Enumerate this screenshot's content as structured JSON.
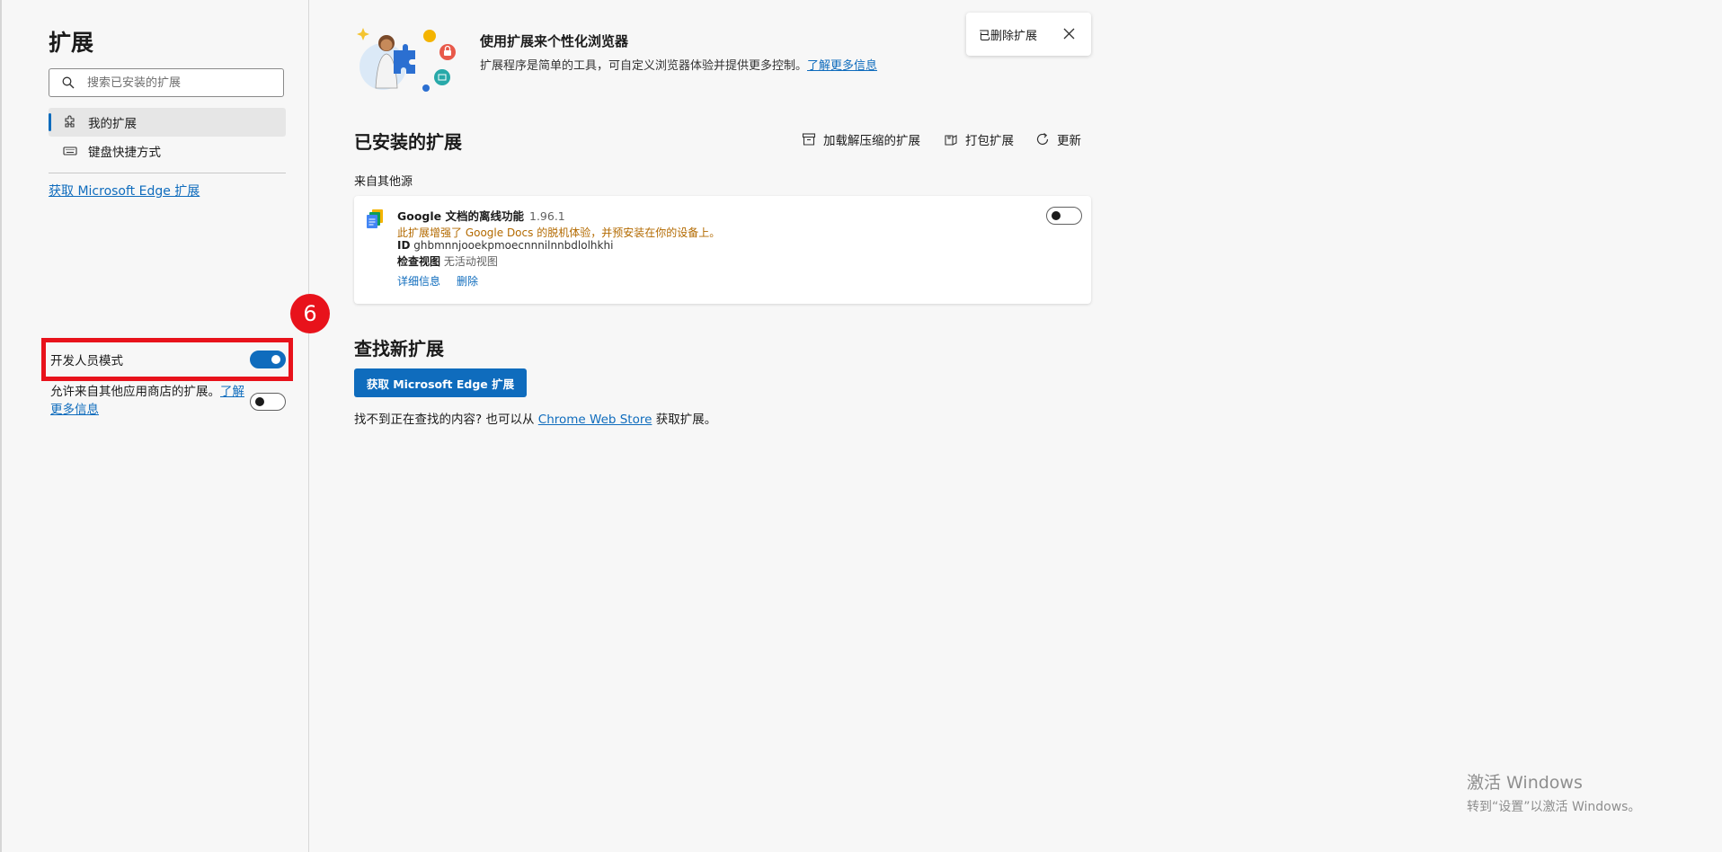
{
  "sidebar": {
    "title": "扩展",
    "search_placeholder": "搜索已安装的扩展",
    "items": [
      {
        "label": "我的扩展",
        "icon": "puzzle-icon",
        "active": true
      },
      {
        "label": "键盘快捷方式",
        "icon": "keyboard-icon",
        "active": false
      }
    ],
    "get_link": "获取 Microsoft Edge 扩展",
    "step_badge": "6",
    "developer_mode": {
      "label": "开发人员模式",
      "on": true
    },
    "allow_other_stores": {
      "text": "允许来自其他应用商店的扩展。",
      "link": "了解更多信息",
      "on": false
    }
  },
  "header": {
    "title": "使用扩展来个性化浏览器",
    "description": "扩展程序是简单的工具，可自定义浏览器体验并提供更多控制。",
    "learn_more": "了解更多信息"
  },
  "toast": {
    "text": "已删除扩展",
    "icon": "close-icon"
  },
  "installed": {
    "title": "已安装的扩展",
    "actions": [
      {
        "label": "加载解压缩的扩展",
        "icon": "archive-icon"
      },
      {
        "label": "打包扩展",
        "icon": "package-icon"
      },
      {
        "label": "更新",
        "icon": "refresh-icon"
      }
    ],
    "source_label": "来自其他源",
    "extension": {
      "name": "Google 文档的离线功能",
      "version": "1.96.1",
      "description": "此扩展增强了 Google Docs 的脱机体验，并预安装在你的设备上。",
      "id_label": "ID",
      "id": "ghbmnnjooekpmoecnnnilnnbdlolhkhi",
      "inspect_label": "检查视图",
      "inspect_value": "无活动视图",
      "details": "详细信息",
      "remove": "删除",
      "enabled": false
    }
  },
  "find_new": {
    "title": "查找新扩展",
    "button": "获取 Microsoft Edge 扩展",
    "hint_prefix": "找不到正在查找的内容? 也可以从",
    "hint_link": "Chrome Web Store",
    "hint_suffix": "获取扩展。"
  },
  "watermark": {
    "line1": "激活 Windows",
    "line2": "转到“设置”以激活 Windows。"
  },
  "colors": {
    "accent": "#0f6cbd",
    "highlight": "#e8121b",
    "warning_text": "#b36a00"
  }
}
